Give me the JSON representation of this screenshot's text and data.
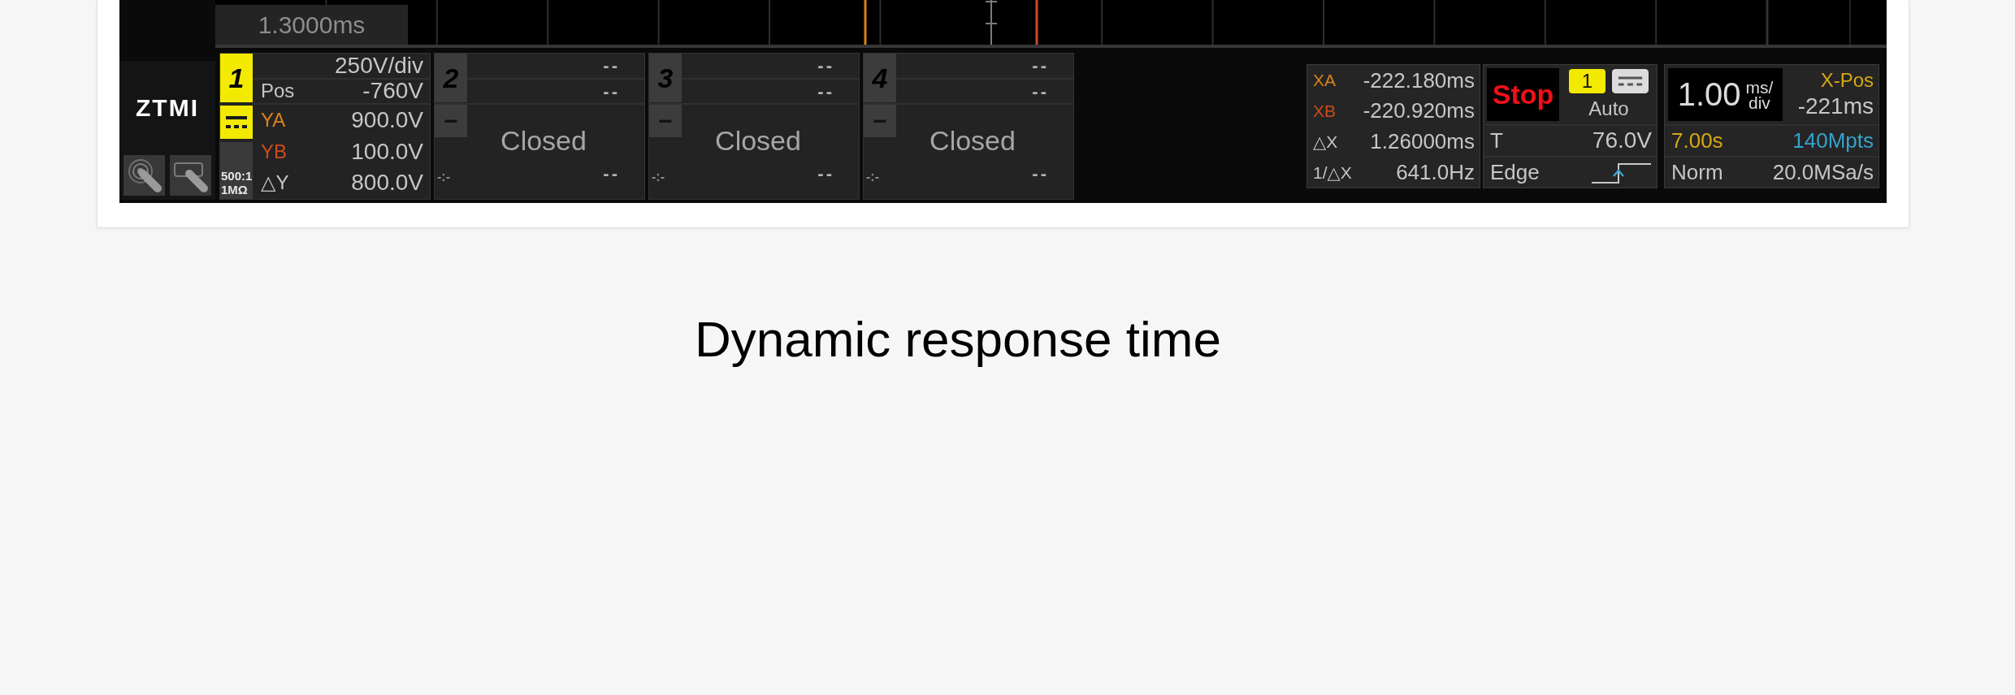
{
  "waveform": {
    "cursor_readout": "1.3000ms"
  },
  "logo": "ZTMI",
  "channels": [
    {
      "number": "1",
      "on": true,
      "scale": "250V/div",
      "position_label": "Pos",
      "position": "-760V",
      "cursors": [
        {
          "label": "YA",
          "value": "900.0V",
          "color": "#d9821a"
        },
        {
          "label": "YB",
          "value": "100.0V",
          "color": "#cc4a1e"
        },
        {
          "label": "△Y",
          "value": "800.0V",
          "color": "#c4c4c4"
        }
      ],
      "probe": "500:1",
      "impedance": "1MΩ"
    },
    {
      "number": "2",
      "on": false,
      "scale": "--",
      "position": "--",
      "coupling": "−",
      "status": "Closed",
      "probe": "-:-",
      "delta": "--"
    },
    {
      "number": "3",
      "on": false,
      "scale": "--",
      "position": "--",
      "coupling": "−",
      "status": "Closed",
      "probe": "-:-",
      "delta": "--"
    },
    {
      "number": "4",
      "on": false,
      "scale": "--",
      "position": "--",
      "coupling": "−",
      "status": "Closed",
      "probe": "-:-",
      "delta": "--"
    }
  ],
  "cursors": [
    {
      "label": "XA",
      "value": "-222.180ms",
      "color": "#d9821a"
    },
    {
      "label": "XB",
      "value": "-220.920ms",
      "color": "#cc4a1e"
    },
    {
      "label": "△X",
      "value": "1.26000ms",
      "color": "#c4c4c4"
    },
    {
      "label": "1/△X",
      "value": "641.0Hz",
      "color": "#c4c4c4"
    }
  ],
  "trigger": {
    "run_state": "Stop",
    "source": "1",
    "mode": "Auto",
    "threshold_label": "T",
    "threshold": "76.0V",
    "type": "Edge"
  },
  "timebase": {
    "scale": "1.00",
    "unit_top": "ms/",
    "unit_bottom": "div",
    "offset_label": "X-Pos",
    "offset": "-221ms",
    "duration": "7.00s",
    "memory_depth": "140Mpts",
    "acquisition": "Norm",
    "sample_rate": "20.0MSa/s"
  },
  "caption": "Dynamic response time"
}
